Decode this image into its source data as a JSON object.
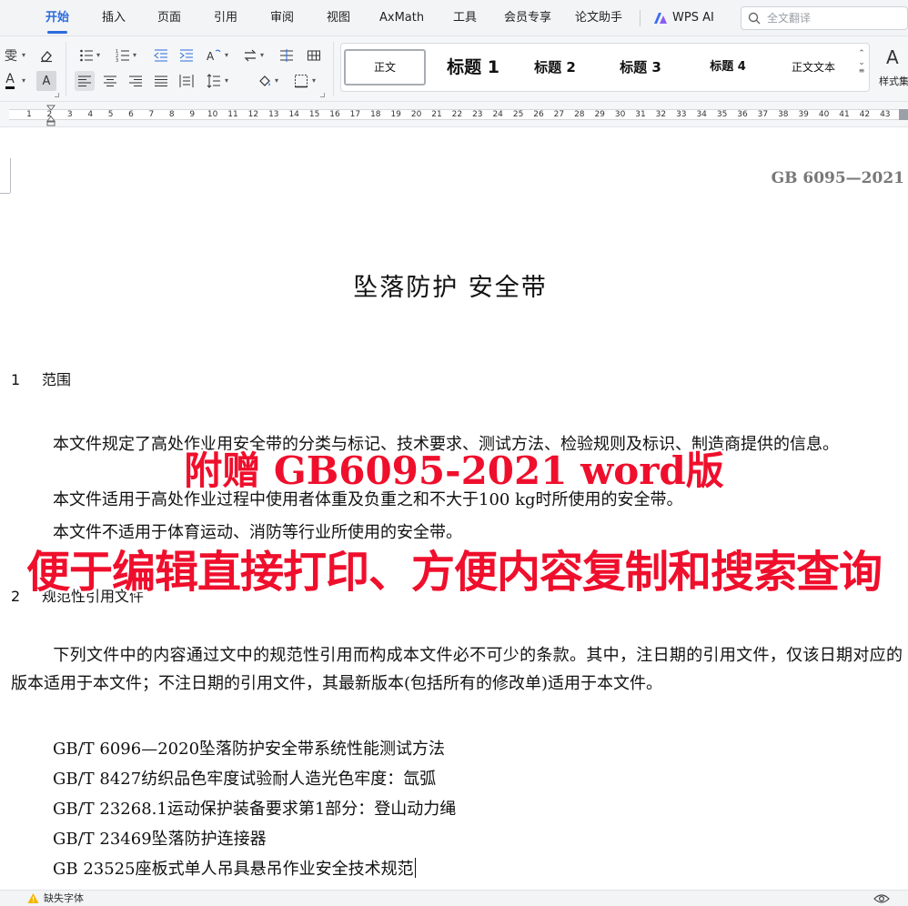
{
  "menu": {
    "tabs": [
      "开始",
      "插入",
      "页面",
      "引用",
      "审阅",
      "视图",
      "AxMath",
      "工具",
      "会员专享",
      "论文助手"
    ],
    "active_tab": "开始",
    "ai_label": "WPS AI",
    "search_placeholder": "全文翻译"
  },
  "ribbon": {
    "styles": [
      "正文",
      "标题 1",
      "标题 2",
      "标题 3",
      "标题 4",
      "正文文本"
    ],
    "current_style": "正文",
    "styleset_label": "样式集",
    "wubi_glyph": "雯",
    "highlight_glyph": "A",
    "font_color_glyph": "A"
  },
  "ruler": {
    "numbers": [
      "1",
      "2",
      "3",
      "4",
      "5",
      "6",
      "7",
      "8",
      "9",
      "10",
      "11",
      "12",
      "13",
      "14",
      "15",
      "16",
      "17",
      "18",
      "19",
      "20",
      "21",
      "22",
      "23",
      "24",
      "25",
      "26",
      "27",
      "28",
      "29",
      "30",
      "31",
      "32",
      "33",
      "34",
      "35",
      "36",
      "37",
      "38",
      "39",
      "40",
      "41",
      "42",
      "43"
    ]
  },
  "document": {
    "code": "GB 6095—2021",
    "title": "坠落防护 安全带",
    "section1": {
      "num": "1",
      "title": "范围"
    },
    "section1_paras": [
      "本文件规定了高处作业用安全带的分类与标记、技术要求、测试方法、检验规则及标识、制造商提供的信息。",
      "本文件适用于高处作业过程中使用者体重及负重之和不大于100 kg时所使用的安全带。",
      "本文件不适用于体育运动、消防等行业所使用的安全带。"
    ],
    "section2": {
      "num": "2",
      "title": "规范性引用文件"
    },
    "section2_para": "下列文件中的内容通过文中的规范性引用而构成本文件必不可少的条款。其中，注日期的引用文件，仅该日期对应的版本适用于本文件；不注日期的引用文件，其最新版本(包括所有的修改单)适用于本文件。",
    "references": [
      "GB/T 6096—2020坠落防护安全带系统性能测试方法",
      "GB/T 8427纺织品色牢度试验耐人造光色牢度：氙弧",
      "GB/T 23268.1运动保护装备要求第1部分：登山动力绳",
      "GB/T 23469坠落防护连接器",
      "GB  23525座板式单人吊具悬吊作业安全技术规范"
    ]
  },
  "overlay": {
    "line1": "附赠 GB6095-2021 word版",
    "line2": "便于编辑直接打印、方便内容复制和搜索查询"
  },
  "status": {
    "missing_fonts": "缺失字体"
  },
  "colors": {
    "accent": "#2b6cde",
    "overlay_red": "#ef0f2c"
  }
}
